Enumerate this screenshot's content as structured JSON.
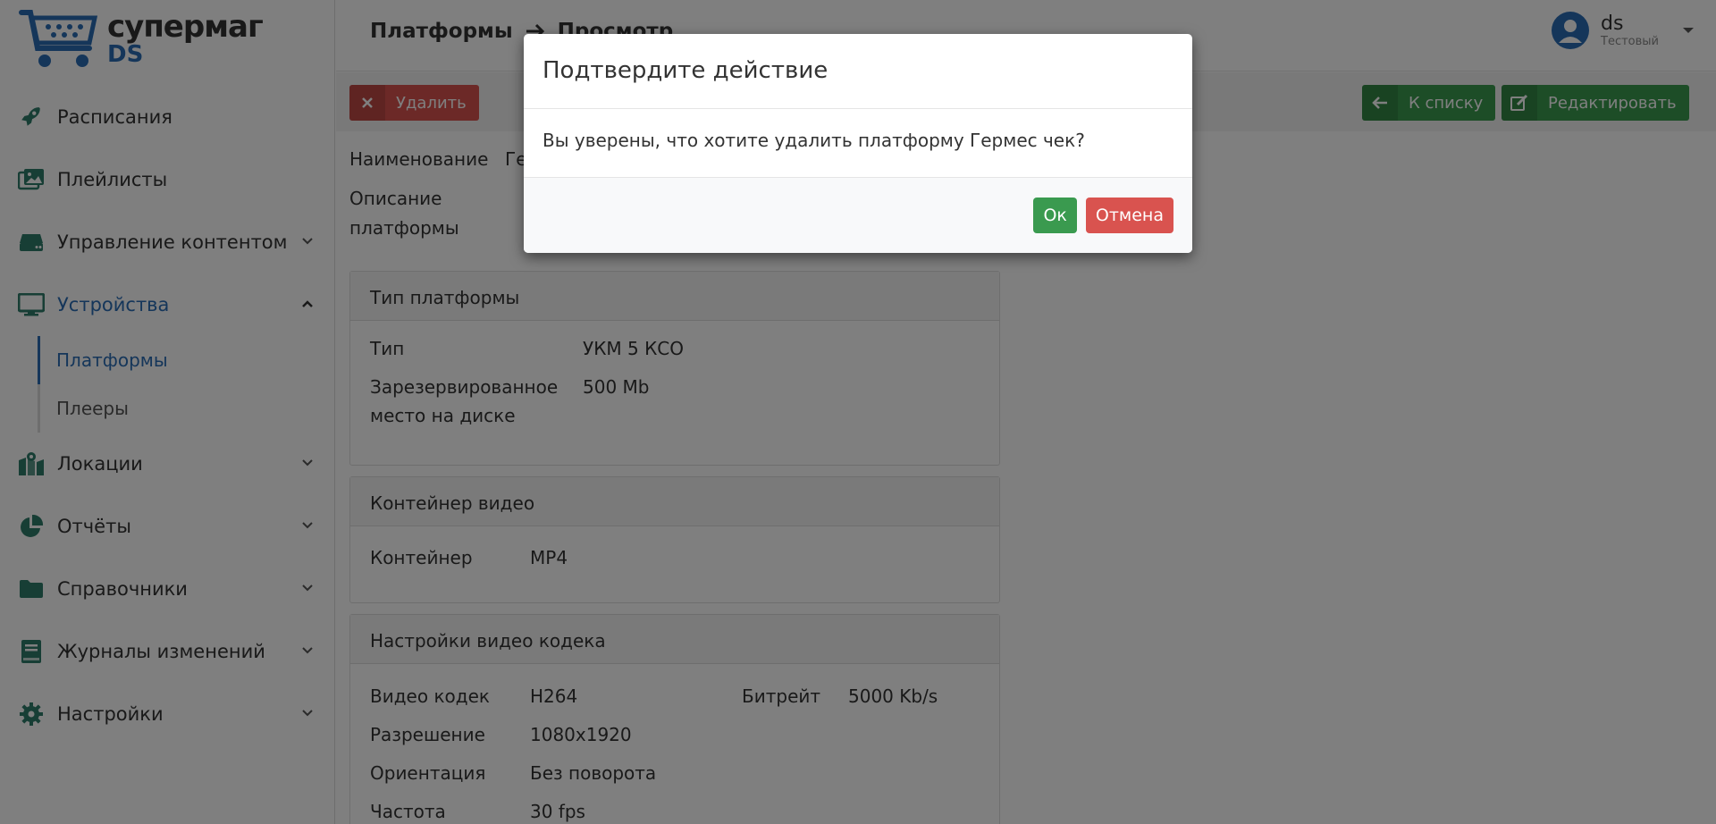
{
  "logo": {
    "line1": "супермаг",
    "line2": "DS"
  },
  "sidebar": {
    "items": [
      {
        "label": "Расписания",
        "icon": "rocket-icon"
      },
      {
        "label": "Плейлисты",
        "icon": "images-icon"
      },
      {
        "label": "Управление контентом",
        "icon": "hdd-icon"
      },
      {
        "label": "Устройства",
        "icon": "monitor-icon"
      },
      {
        "label": "Локации",
        "icon": "map-icon"
      },
      {
        "label": "Отчёты",
        "icon": "pie-chart-icon"
      },
      {
        "label": "Справочники",
        "icon": "folder-icon"
      },
      {
        "label": "Журналы изменений",
        "icon": "book-icon"
      },
      {
        "label": "Настройки",
        "icon": "gear-icon"
      }
    ],
    "sub_items": [
      {
        "label": "Платформы"
      },
      {
        "label": "Плееры"
      }
    ]
  },
  "header": {
    "crumb1": "Платформы",
    "crumb2": "Просмотр",
    "user_name": "ds",
    "user_role": "Тестовый"
  },
  "toolbar": {
    "delete_label": "Удалить",
    "back_label": "К списку",
    "edit_label": "Редактировать"
  },
  "details": {
    "name_label": "Наименование",
    "name_value": "Гермес чек",
    "desc_label_1": "Описание",
    "desc_label_2": "платформы"
  },
  "panels": {
    "type": {
      "title": "Тип платформы",
      "type_label": "Тип",
      "type_value": "УКМ 5 КСО",
      "reserved_label_1": "Зарезервированное",
      "reserved_label_2": "место на диске",
      "reserved_value": "500 Mb"
    },
    "container": {
      "title": "Контейнер видео",
      "label": "Контейнер",
      "value": "MP4"
    },
    "codec": {
      "title": "Настройки видео кодека",
      "codec_label": "Видео кодек",
      "codec_value": "H264",
      "bitrate_label": "Битрейт",
      "bitrate_value": "5000 Kb/s",
      "res_label": "Разрешение",
      "res_value": "1080x1920",
      "orient_label": "Ориентация",
      "orient_value": "Без поворота",
      "freq_label": "Частота",
      "freq_value": "30 fps"
    }
  },
  "modal": {
    "title": "Подтвердите действие",
    "message": "Вы уверены, что хотите удалить платформу Гермес чек?",
    "ok_label": "Ок",
    "cancel_label": "Отмена"
  },
  "colors": {
    "accent": "#2a6db5",
    "success": "#3a9a4f",
    "danger": "#d9534f",
    "icon_green": "#2e7d6b"
  }
}
